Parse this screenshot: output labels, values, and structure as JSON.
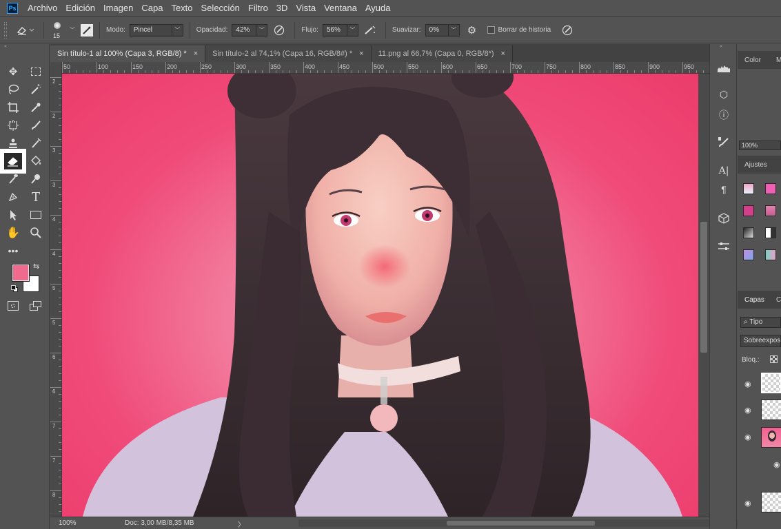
{
  "app": {
    "logo": "Ps"
  },
  "menu": [
    "Archivo",
    "Edición",
    "Imagen",
    "Capa",
    "Texto",
    "Selección",
    "Filtro",
    "3D",
    "Vista",
    "Ventana",
    "Ayuda"
  ],
  "options": {
    "brush_size": "15",
    "mode_label": "Modo:",
    "mode_value": "Pincel",
    "opacity_label": "Opacidad:",
    "opacity_value": "42%",
    "flow_label": "Flujo:",
    "flow_value": "56%",
    "smooth_label": "Suavizar:",
    "smooth_value": "0%",
    "erase_history_label": "Borrar de historia"
  },
  "tabs": [
    {
      "label": "Sin título-1 al 100% (Capa 3, RGB/8) *",
      "close": "×"
    },
    {
      "label": "Sin título-2 al 74,1% (Capa 16, RGB/8#) *",
      "close": "×"
    },
    {
      "label": "11.png al 66,7% (Capa 0, RGB/8*)",
      "close": "×"
    }
  ],
  "ruler": {
    "h_labels": [
      "50",
      "100",
      "150",
      "200",
      "250",
      "300",
      "350",
      "400",
      "450",
      "500",
      "550",
      "600",
      "650",
      "700",
      "750",
      "800",
      "850",
      "900",
      "950"
    ],
    "v_labels": [
      "2",
      "2",
      "3",
      "3",
      "4",
      "4",
      "5",
      "5",
      "6",
      "6",
      "7",
      "7",
      "8"
    ]
  },
  "status": {
    "zoom": "100%",
    "doc": "Doc: 3,00 MB/8,35 MB"
  },
  "colors": {
    "foreground": "#f06a8e",
    "background": "#ffffff"
  },
  "right_panel": {
    "color_tab": "Color",
    "color_tab2": "M",
    "zoom_value": "100%",
    "adjustments_tab": "Ajustes",
    "layers_tab": "Capas",
    "layers_tab2": "C",
    "filter_label": "Tipo",
    "blend_mode": "Sobreexpos",
    "lock_label": "Bloq.:"
  },
  "toolbar_icons": [
    "move-icon",
    "marquee-icon",
    "lasso-icon",
    "magic-wand-icon",
    "crop-icon",
    "eyedropper-icon",
    "frame-icon",
    "brush-icon",
    "stamp-icon",
    "history-brush-icon",
    "eraser-icon",
    "paint-bucket-icon",
    "smudge-icon",
    "dodge-icon",
    "pen-icon",
    "type-icon",
    "path-select-icon",
    "rectangle-icon",
    "hand-icon",
    "zoom-icon"
  ]
}
